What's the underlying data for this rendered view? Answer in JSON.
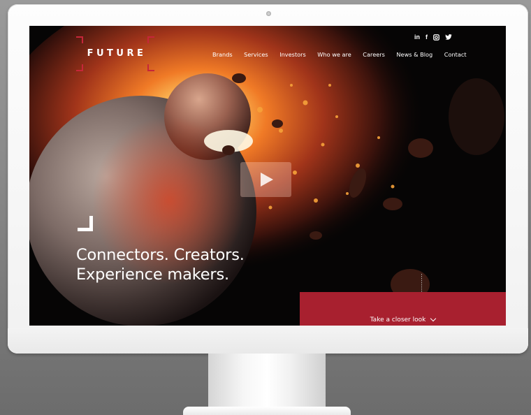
{
  "brand": {
    "name": "FUTURE",
    "accent": "#c6263a"
  },
  "social": [
    {
      "icon": "linkedin-icon",
      "label": "in"
    },
    {
      "icon": "facebook-icon",
      "label": "f"
    },
    {
      "icon": "instagram-icon",
      "label": "◙"
    },
    {
      "icon": "twitter-icon",
      "label": "🐦"
    }
  ],
  "nav": {
    "items": [
      "Brands",
      "Services",
      "Investors",
      "Who we are",
      "Careers",
      "News & Blog",
      "Contact"
    ]
  },
  "hero": {
    "line1": "Connectors. Creators.",
    "line2": "Experience makers."
  },
  "cta": {
    "label": "Take a closer look",
    "color": "#a8202f"
  },
  "play": {
    "icon": "play-icon"
  }
}
